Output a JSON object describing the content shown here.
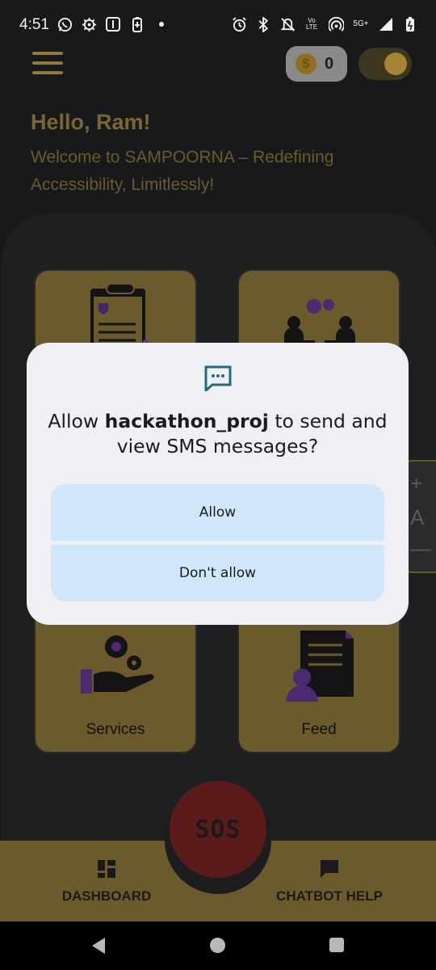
{
  "status_bar": {
    "time": "4:51",
    "network_label": "5G+",
    "volte_label": "Vo LTE",
    "left_icons": [
      "whatsapp-icon",
      "settings-gear-icon",
      "notification-badge-icon",
      "battery-saver-icon",
      "dot-icon"
    ],
    "right_icons": [
      "alarm-icon",
      "bluetooth-icon",
      "mute-icon",
      "volte-icon",
      "hotspot-icon",
      "signal-icon",
      "battery-icon"
    ]
  },
  "header": {
    "coin_symbol": "$",
    "coin_count": "0",
    "greeting": "Hello, Ram!",
    "welcome": "Welcome to SAMPOORNA – Redefining Accessibility, Limitlessly!"
  },
  "cards": [
    {
      "label": ""
    },
    {
      "label": ""
    },
    {
      "label": "Services"
    },
    {
      "label": "Feed"
    }
  ],
  "zoom": {
    "plus": "+",
    "letter": "A",
    "minus": "—"
  },
  "sos": {
    "label": "SOS"
  },
  "bottom_nav": {
    "dashboard_label": "DASHBOARD",
    "chatbot_label": "CHATBOT HELP"
  },
  "dialog": {
    "prefix": "Allow ",
    "app_name": "hackathon_proj",
    "suffix": " to send and view SMS messages?",
    "allow_label": "Allow",
    "deny_label": "Don't allow"
  },
  "colors": {
    "background": "#18191b",
    "gold": "#6b5a2c",
    "dialog_bg": "#eef0f3",
    "dialog_button": "#cfe6fb",
    "sos_red": "#5c1b1b",
    "purple_accent": "#4a2a70"
  }
}
